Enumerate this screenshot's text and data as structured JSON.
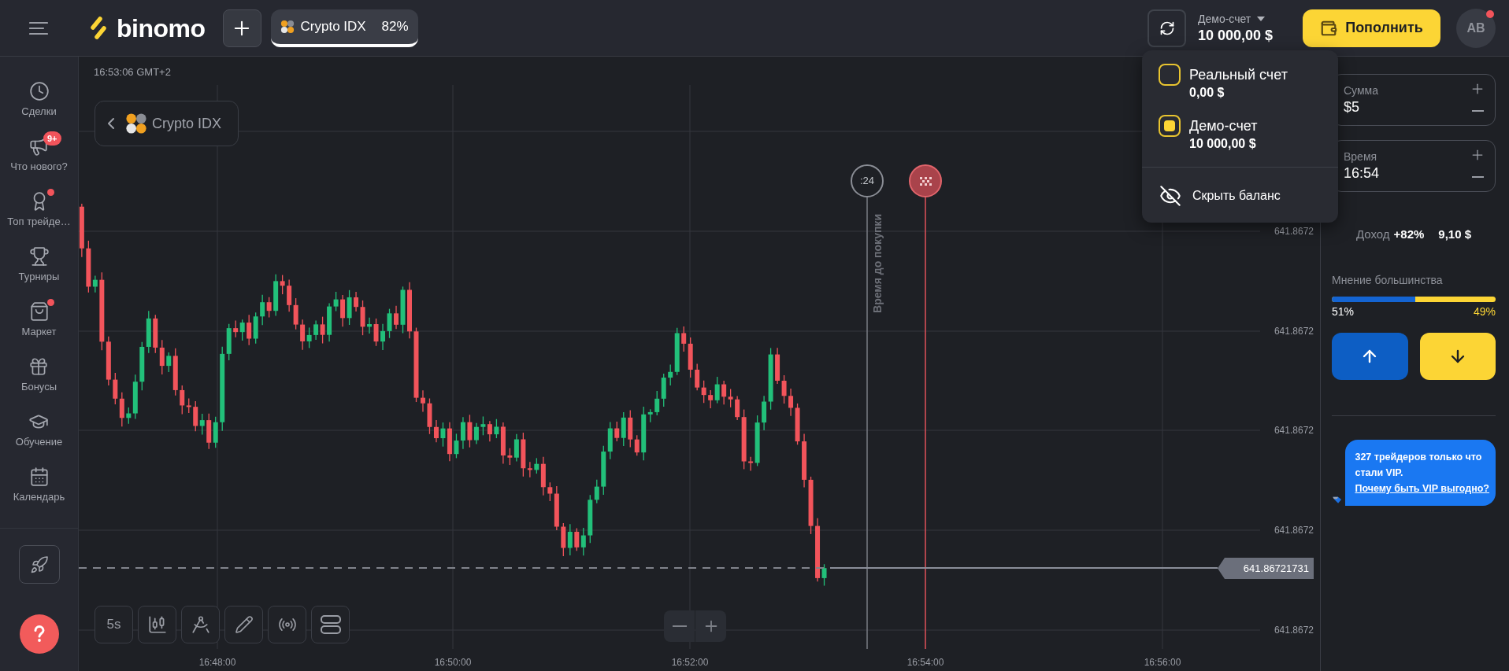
{
  "header": {
    "logo": "binomo",
    "asset_tabs": [
      {
        "name": "Crypto IDX",
        "payout": "82%",
        "selected": true
      }
    ],
    "account": {
      "label": "Демо-счет",
      "balance": "10 000,00 $"
    },
    "deposit_button": "Пополнить",
    "avatar": {
      "initials": "AB",
      "notification": true
    }
  },
  "account_menu": {
    "accounts": [
      {
        "name": "Реальный счет",
        "balance": "0,00 $",
        "selected": false
      },
      {
        "name": "Демо-счет",
        "balance": "10 000,00 $",
        "selected": true
      }
    ],
    "hide_balance": "Скрыть баланс"
  },
  "sidebar": {
    "items": [
      {
        "label": "Сделки",
        "notification": false
      },
      {
        "label": "Что нового?",
        "notification": false,
        "badge": "9+"
      },
      {
        "label": "Топ трейде…",
        "notification": true
      },
      {
        "label": "Турниры",
        "notification": false
      },
      {
        "label": "Маркет",
        "notification": true
      },
      {
        "label": "Бонусы",
        "notification": false
      },
      {
        "label": "Обучение",
        "notification": false
      },
      {
        "label": "Календарь",
        "notification": false
      }
    ]
  },
  "chart": {
    "clock": "16:53:06 GMT+2",
    "asset": "Crypto IDX",
    "countdown": ":24",
    "purchase_deadline": "Время до покупки",
    "price_labels": [
      "641.8672",
      "641.8672",
      "641.8672",
      "641.8672",
      "641.8672"
    ],
    "current_price": "641.86721731",
    "time_labels": [
      "16:48:00",
      "16:50:00",
      "16:52:00",
      "16:54:00",
      "16:56:00"
    ],
    "timeframe": "5s"
  },
  "trade_panel": {
    "amount": {
      "label": "Сумма",
      "value": "$5"
    },
    "time": {
      "label": "Время",
      "value": "16:54"
    },
    "profit": {
      "label": "Доход",
      "percent": "+82%",
      "value": "9,10 $"
    },
    "sentiment": {
      "title": "Мнение большинства",
      "level": 0.51,
      "up": "51%",
      "down": "49%"
    },
    "vip_banner": {
      "text": "327 трейдеров только что стали VIP.",
      "link": "Почему быть VIP выгодно?"
    }
  }
}
